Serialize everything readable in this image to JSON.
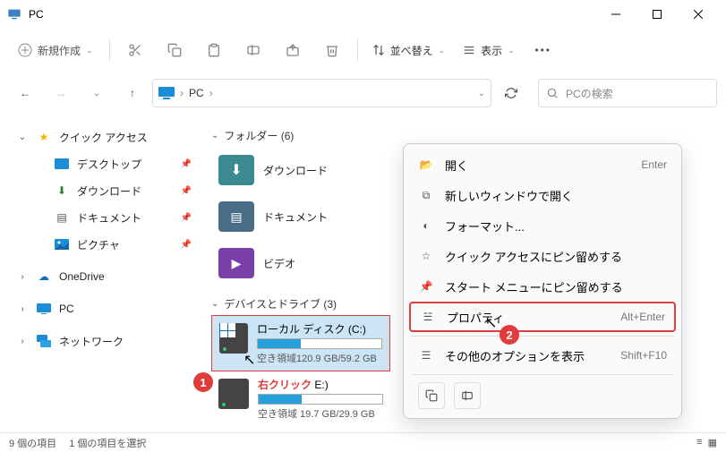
{
  "titlebar": {
    "title": "PC"
  },
  "toolbar": {
    "new_label": "新規作成",
    "sort_label": "並べ替え",
    "view_label": "表示"
  },
  "addr": {
    "crumb1": "PC",
    "sep": "›"
  },
  "search": {
    "placeholder": "PCの検索"
  },
  "sidebar": {
    "quick_access": "クイック アクセス",
    "desktop": "デスクトップ",
    "downloads": "ダウンロード",
    "documents": "ドキュメント",
    "pictures": "ピクチャ",
    "onedrive": "OneDrive",
    "pc": "PC",
    "network": "ネットワーク"
  },
  "main": {
    "folders_header": "フォルダー (6)",
    "folders": {
      "downloads": "ダウンロード",
      "documents": "ドキュメント",
      "videos": "ビデオ"
    },
    "drives_header": "デバイスとドライブ (3)",
    "drive_c": {
      "name": "ローカル ディスク (C:)",
      "space": "空き領域120.9 GB/59.2 GB",
      "fill_pct": 35
    },
    "drive_e": {
      "name": "E:)",
      "space": "空き領域 19.7 GB/29.9 GB",
      "fill_pct": 35
    }
  },
  "ctx": {
    "open": "開く",
    "open_accel": "Enter",
    "new_window": "新しいウィンドウで開く",
    "format": "フォーマット...",
    "pin_quick": "クイック アクセスにピン留めする",
    "pin_start": "スタート メニューにピン留めする",
    "properties": "プロパティ",
    "properties_accel": "Alt+Enter",
    "more": "その他のオプションを表示",
    "more_accel": "Shift+F10"
  },
  "status": {
    "items": "9 個の項目",
    "selected": "1 個の項目を選択"
  },
  "annotation": {
    "label": "右クリック",
    "b1": "1",
    "b2": "2"
  }
}
